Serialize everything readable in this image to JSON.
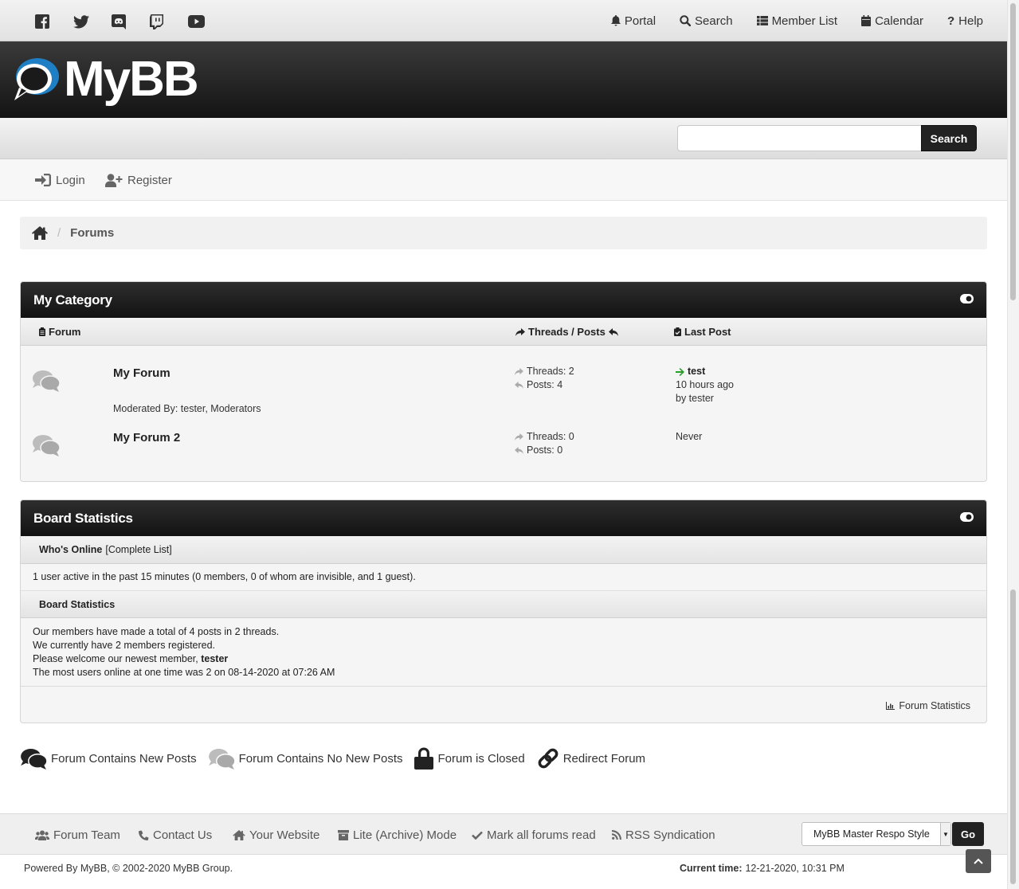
{
  "social": [
    "facebook-icon",
    "twitter-icon",
    "discord-icon",
    "twitch-icon",
    "youtube-icon"
  ],
  "topnav": {
    "portal": "Portal",
    "search": "Search",
    "memberlist": "Member List",
    "calendar": "Calendar",
    "help": "Help"
  },
  "logo": {
    "text": "MyBB"
  },
  "search": {
    "placeholder": "",
    "button": "Search"
  },
  "userbar": {
    "login": "Login",
    "register": "Register"
  },
  "breadcrumb": {
    "sep": "/",
    "current": "Forums"
  },
  "category": {
    "title": "My Category",
    "columns": {
      "forum": "Forum",
      "threads_posts": "Threads / Posts",
      "last_post": "Last Post"
    },
    "forums": [
      {
        "name": "My Forum",
        "moderated_by": "Moderated By: tester, Moderators",
        "threads": "Threads: 2",
        "posts": "Posts: 4",
        "last_post_title": "test",
        "last_post_time": "10 hours ago",
        "last_post_by": "by tester"
      },
      {
        "name": "My Forum 2",
        "threads": "Threads: 0",
        "posts": "Posts: 0",
        "last_post": "Never"
      }
    ]
  },
  "board_stats": {
    "title": "Board Statistics",
    "whos_online_label": "Who's Online",
    "complete_list": "[Complete List]",
    "online_text": "1 user active in the past 15 minutes (0 members, 0 of whom are invisible, and 1 guest).",
    "stats_label": "Board Statistics",
    "line1": "Our members have made a total of 4 posts in 2 threads.",
    "line2": "We currently have 2 members registered.",
    "line3_prefix": "Please welcome our newest member,",
    "newest_member": "tester",
    "line4": "The most users online at one time was 2 on 08-14-2020 at 07:26 AM",
    "forum_statistics": "Forum Statistics"
  },
  "legend": {
    "new_posts": "Forum Contains New Posts",
    "no_new_posts": "Forum Contains No New Posts",
    "closed": "Forum is Closed",
    "redirect": "Redirect Forum"
  },
  "footer": {
    "forum_team": "Forum Team",
    "contact_us": "Contact Us",
    "your_website": "Your Website",
    "lite_mode": "Lite (Archive) Mode",
    "mark_read": "Mark all forums read",
    "rss": "RSS Syndication",
    "style_selected": "MyBB Master Respo Style",
    "go": "Go",
    "powered_by": "Powered By MyBB, © 2002-2020 MyBB Group.",
    "current_time_label": "Current time:",
    "current_time": "12-21-2020, 10:31 PM"
  },
  "colors": {
    "accent_green": "#2a9d2a",
    "header_dark": "#1a1a1a",
    "logo_blue": "#1f7fc4"
  }
}
